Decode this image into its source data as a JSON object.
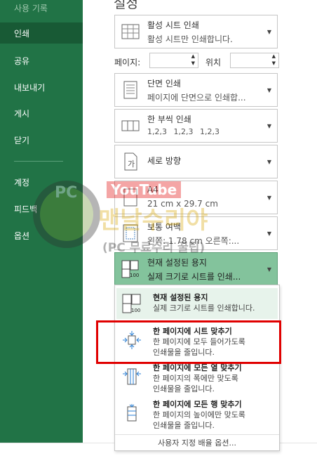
{
  "sidebar": {
    "items": [
      {
        "label": "사용 기록"
      },
      {
        "label": "인쇄"
      },
      {
        "label": "공유"
      },
      {
        "label": "내보내기"
      },
      {
        "label": "게시"
      },
      {
        "label": "닫기"
      },
      {
        "label": "계정"
      },
      {
        "label": "피드백"
      },
      {
        "label": "옵션"
      }
    ]
  },
  "main": {
    "heading": "설정",
    "print_what": {
      "title": "활성 시트 인쇄",
      "desc": "활성 시트만 인쇄합니다."
    },
    "pages_label": "페이지:",
    "to_label": "위치",
    "sides": {
      "title": "단면 인쇄",
      "desc": "페이지에 단면으로 인쇄합..."
    },
    "collate": {
      "title": "한 부씩 인쇄",
      "desc": "1,2,3    1,2,3    1,2,3"
    },
    "orientation": {
      "title": "세로 방향"
    },
    "paper": {
      "title": "A4",
      "desc": "21 cm x 29.7 cm"
    },
    "margins": {
      "title": "보통 여백",
      "desc": "왼쪽:  1.78 cm    오른쪽:..."
    },
    "scaling": {
      "title": "현재 설정된 용지",
      "desc": "실제 크기로 시트를 인쇄..."
    }
  },
  "dropdown": {
    "items": [
      {
        "title": "현재 설정된 용지",
        "line1": "실제 크기로 시트를 인쇄합니다.",
        "line2": ""
      },
      {
        "title": "한 페이지에 시트 맞추기",
        "line1": "한 페이지에 모두 들어가도록",
        "line2": "인쇄물을 줄입니다."
      },
      {
        "title": "한 페이지에 모든 열 맞추기",
        "line1": "한 페이지의 폭에만 맞도록",
        "line2": "인쇄물을 줄입니다."
      },
      {
        "title": "한 페이지에 모든 행 맞추기",
        "line1": "한 페이지의 높이에만 맞도록",
        "line2": "인쇄물을 줄입니다."
      }
    ],
    "footer": "사용자 지정 배율 옵션..."
  },
  "watermark": {
    "line1": "PC",
    "line2": "YouTube",
    "line3": "맨날수리야",
    "line4": "(PC 무료수리 꿀팁)"
  },
  "colors": {
    "sidebar": "#217346",
    "selected": "#185a35",
    "highlight_red": "#e00000",
    "green_select": "#83c39c"
  }
}
